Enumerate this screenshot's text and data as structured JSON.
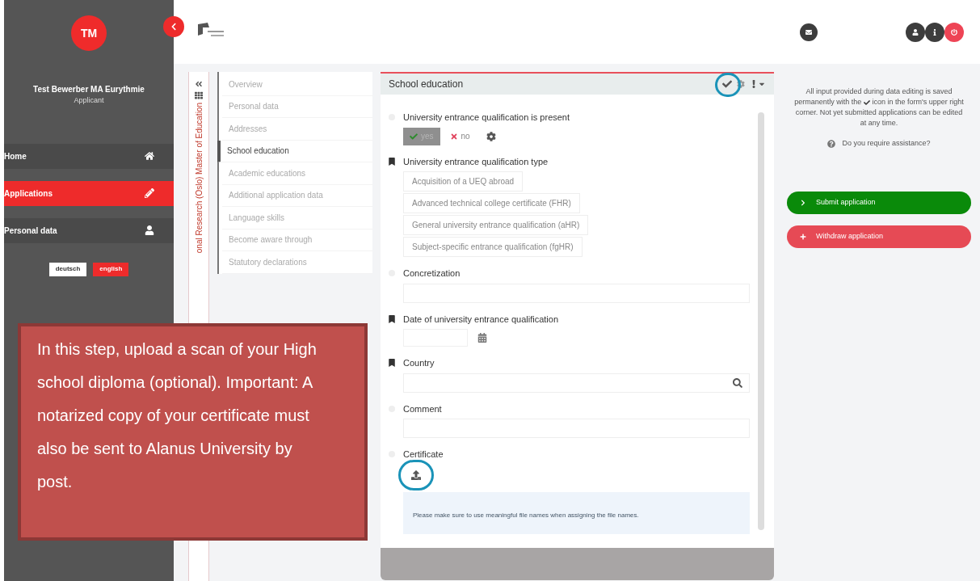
{
  "sidebar": {
    "avatar": "TM",
    "user_name": "Test Bewerber MA Eurythmie",
    "role": "Applicant",
    "nav": [
      {
        "label": "Home",
        "selected": false
      },
      {
        "label": "Applications",
        "selected": true
      },
      {
        "label": "Personal data",
        "selected": false
      }
    ],
    "languages": [
      {
        "label": "deutsch",
        "selected": false
      },
      {
        "label": "english",
        "selected": true
      }
    ]
  },
  "program_title": "onal Research (Oslo) Master of Education",
  "steps": [
    {
      "label": "Overview",
      "selected": false
    },
    {
      "label": "Personal data",
      "selected": false
    },
    {
      "label": "Addresses",
      "selected": false
    },
    {
      "label": "School education",
      "selected": true
    },
    {
      "label": "Academic educations",
      "selected": false
    },
    {
      "label": "Additional application data",
      "selected": false
    },
    {
      "label": "Language skills",
      "selected": false
    },
    {
      "label": "Become aware through",
      "selected": false
    },
    {
      "label": "Statutory declarations",
      "selected": false
    }
  ],
  "form": {
    "title": "School education",
    "fields": [
      {
        "kind": "toggle",
        "label": "University entrance qualification is present",
        "required": false,
        "options": [
          {
            "label": "yes",
            "selected": true
          },
          {
            "label": "no",
            "selected": false
          }
        ]
      },
      {
        "kind": "choices",
        "label": "University entrance qualification type",
        "required": true,
        "options": [
          "Acquisition of a UEQ abroad",
          "Advanced technical college certificate (FHR)",
          "General university entrance qualification (aHR)",
          "Subject-specific entrance qualification (fgHR)"
        ]
      },
      {
        "kind": "text",
        "label": "Concretization",
        "required": false
      },
      {
        "kind": "date",
        "label": "Date of university entrance qualification",
        "required": true
      },
      {
        "kind": "search",
        "label": "Country",
        "required": true
      },
      {
        "kind": "text",
        "label": "Comment",
        "required": false
      },
      {
        "kind": "upload",
        "label": "Certificate",
        "required": false,
        "hint": "Please make sure to use meaningful file names when assigning the file names."
      }
    ]
  },
  "info": {
    "text_before": "All input provided during data editing is saved permanently with the",
    "text_after": "icon in the form's upper right corner. Not yet submitted applications can be edited at any time.",
    "assistance": "Do you require assistance?"
  },
  "actions": [
    {
      "kind": "submit",
      "label": "Submit application"
    },
    {
      "kind": "withdraw",
      "label": "Withdraw application"
    }
  ],
  "callout": "In this step, upload a scan of your High school diploma (optional). Important: A notarized copy of your certificate must also be sent to Alanus University by post."
}
